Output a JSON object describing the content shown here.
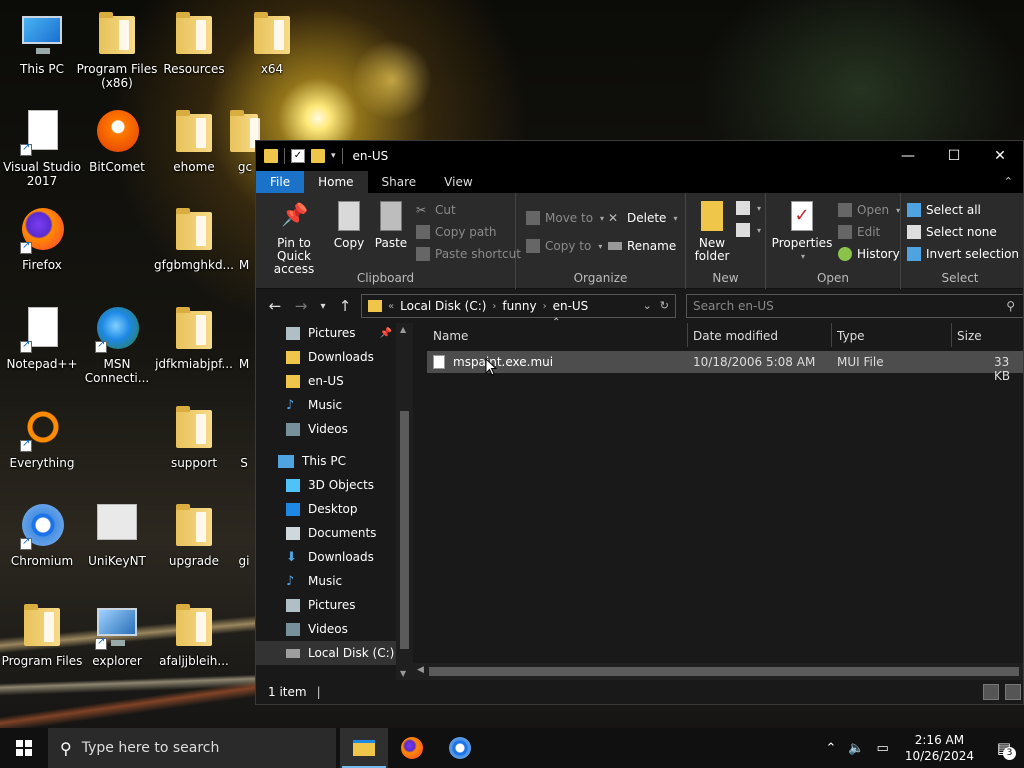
{
  "desktop": {
    "icons": [
      {
        "label": "This PC"
      },
      {
        "label": "Program Files (x86)"
      },
      {
        "label": "Resources"
      },
      {
        "label": "x64"
      },
      {
        "label": "Visual Studio 2017"
      },
      {
        "label": "BitComet"
      },
      {
        "label": "ehome"
      },
      {
        "label": "gc"
      },
      {
        "label": "Firefox"
      },
      {
        "label": "gfgbmghkd..."
      },
      {
        "label": "M"
      },
      {
        "label": "Notepad++"
      },
      {
        "label": "MSN Connecti..."
      },
      {
        "label": "jdfkmiabjpf..."
      },
      {
        "label": "M"
      },
      {
        "label": "Everything"
      },
      {
        "label": "support"
      },
      {
        "label": "S"
      },
      {
        "label": "Chromium"
      },
      {
        "label": "UniKeyNT"
      },
      {
        "label": "upgrade"
      },
      {
        "label": "gi"
      },
      {
        "label": "Program Files"
      },
      {
        "label": "explorer"
      },
      {
        "label": "afaljjbleih..."
      }
    ]
  },
  "explorer": {
    "title": "en-US",
    "tabs": {
      "file": "File",
      "home": "Home",
      "share": "Share",
      "view": "View"
    },
    "ribbon": {
      "clipboard": {
        "group": "Clipboard",
        "pin": "Pin to Quick access",
        "copy": "Copy",
        "paste": "Paste",
        "cut": "Cut",
        "copy_path": "Copy path",
        "paste_shortcut": "Paste shortcut"
      },
      "organize": {
        "group": "Organize",
        "move_to": "Move to",
        "copy_to": "Copy to",
        "delete": "Delete",
        "rename": "Rename"
      },
      "new": {
        "group": "New",
        "new_folder": "New folder"
      },
      "open": {
        "group": "Open",
        "properties": "Properties",
        "open": "Open",
        "edit": "Edit",
        "history": "History"
      },
      "select": {
        "group": "Select",
        "select_all": "Select all",
        "select_none": "Select none",
        "invert": "Invert selection"
      }
    },
    "address": {
      "prefix": "«",
      "crumbs": [
        "Local Disk (C:)",
        "funny",
        "en-US"
      ]
    },
    "search_placeholder": "Search en-US",
    "nav": [
      {
        "label": "Pictures"
      },
      {
        "label": "Downloads"
      },
      {
        "label": "en-US"
      },
      {
        "label": "Music"
      },
      {
        "label": "Videos"
      },
      {
        "label": "This PC"
      },
      {
        "label": "3D Objects"
      },
      {
        "label": "Desktop"
      },
      {
        "label": "Documents"
      },
      {
        "label": "Downloads"
      },
      {
        "label": "Music"
      },
      {
        "label": "Pictures"
      },
      {
        "label": "Videos"
      },
      {
        "label": "Local Disk (C:)"
      }
    ],
    "columns": {
      "name": "Name",
      "date": "Date modified",
      "type": "Type",
      "size": "Size"
    },
    "files": [
      {
        "name": "mspaint.exe.mui",
        "date": "10/18/2006 5:08 AM",
        "type": "MUI File",
        "size": "33 KB"
      }
    ],
    "status": "1 item"
  },
  "taskbar": {
    "search_placeholder": "Type here to search",
    "time": "2:16 AM",
    "date": "10/26/2024",
    "notifications": "3"
  }
}
